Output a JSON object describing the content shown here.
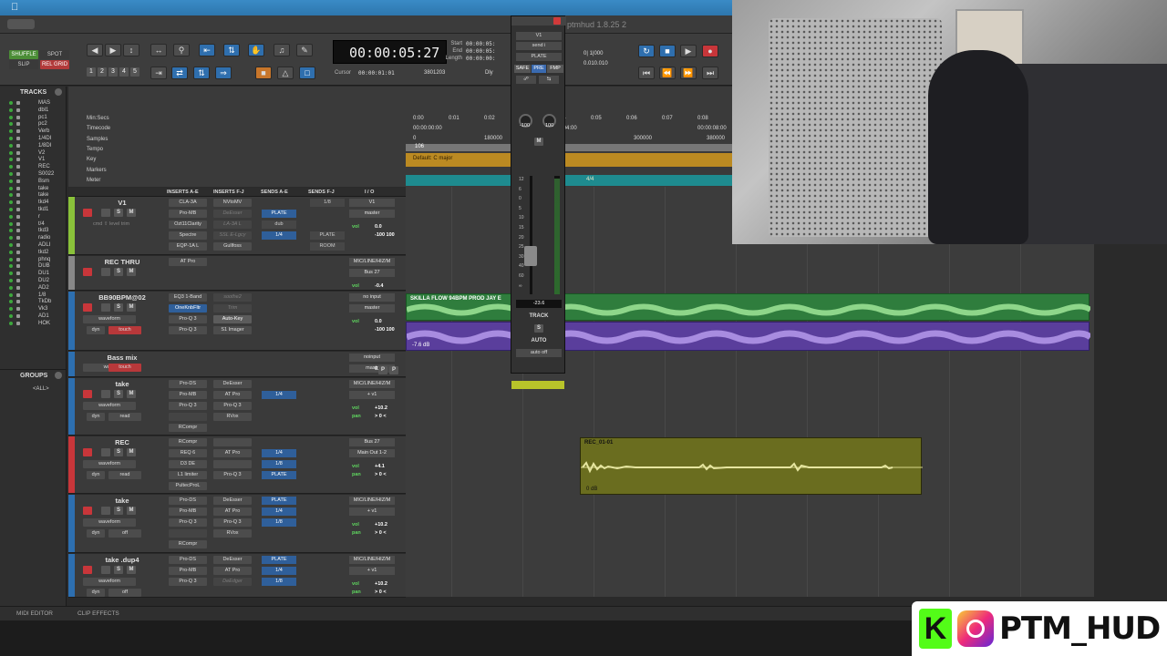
{
  "window": {
    "title": "ptmhud 1.8.25 2"
  },
  "toolbar": {
    "modes": [
      "SHUFFLE",
      "SPOT",
      "SLIP",
      "REL GRID"
    ],
    "counter": "00:00:05:27",
    "start_label": "Start",
    "end_label": "End",
    "length_label": "Length",
    "start_val": "00:00:05:",
    "end_val": "00:00:05:",
    "length_val": "00:00:00:",
    "cursor_label": "Cursor",
    "cursor_val": "00:00:01:01",
    "samples": "3801203",
    "dly_label": "Dly",
    "nudge_vals": [
      "0| 1|000",
      "0.010.010"
    ],
    "zoom_presets": [
      "1",
      "2",
      "3",
      "4",
      "5"
    ]
  },
  "tracks_panel": {
    "title": "TRACKS",
    "items": [
      "MAS",
      "dbl1",
      "pc1",
      "pc2",
      "Verb",
      "1/4DI",
      "1/8DI",
      "V2",
      "V1",
      "REC",
      "S0022",
      "Bsm",
      "take",
      "take",
      "tkd4",
      "tkd1",
      "r",
      "t/4",
      "tkd3",
      "radio",
      "ADLI",
      "tkd2",
      "phnq",
      "DUB",
      "DU1",
      "DU2",
      "AD2",
      "1/8",
      "TkDb",
      "Vk3",
      "AD1",
      "HOK"
    ]
  },
  "groups_panel": {
    "title": "GROUPS",
    "all_label": "<ALL>"
  },
  "rulers": [
    {
      "label": "Min:Secs"
    },
    {
      "label": "Timecode"
    },
    {
      "label": "Samples"
    },
    {
      "label": "Tempo"
    },
    {
      "label": "Key"
    },
    {
      "label": "Markers"
    },
    {
      "label": "Meter"
    }
  ],
  "min_secs_ticks": [
    "0:00",
    "0:01",
    "0:02",
    "0:03",
    "0:04",
    "0:05",
    "0:06",
    "0:07",
    "0:08"
  ],
  "timecode_ticks": [
    "00:00:00:00",
    "00:00:04:00",
    "00:00:08:00"
  ],
  "sample_ticks": [
    "0",
    "180000",
    "300000",
    "380000"
  ],
  "tempo_value": "106",
  "key_text": "Default: C major",
  "meter_text": "4/4",
  "column_headers": [
    "INSERTS A-E",
    "INSERTS F-J",
    "SENDS A-E",
    "SENDS F-J",
    "I / O"
  ],
  "tracks": [
    {
      "name": "V1",
      "color": "#8ac23a",
      "inserts_a": [
        "CLA-3A",
        "Pro-MB",
        "Ozt11Clarity",
        "Spectre",
        "EQP-1A L"
      ],
      "inserts_f": [
        "NVtoMV",
        "DeEsser",
        "LA-3A L",
        "SSL E-Lgcy",
        "Gullfoss"
      ],
      "sends_a": [
        "",
        "PLATE",
        "dub",
        "1/4"
      ],
      "sends_f": [
        "1/8",
        "",
        "",
        "PLATE",
        "ROOM"
      ],
      "io": [
        "V1",
        "master"
      ],
      "vol_label": "vol",
      "vol": "0.0",
      "pan": "-100  100",
      "extra": "cmd ⇧ level trim"
    },
    {
      "name": "REC THRU",
      "color": "#888888",
      "inserts_a": [
        "AT Pro"
      ],
      "io": [
        "MIC/LINE/HIZ/M",
        "Bus 27"
      ],
      "vol_label": "vol",
      "vol": "-0.4"
    },
    {
      "name": "BB90BPM@02",
      "color": "#2d6fb0",
      "inserts_a": [
        "EQ3 1-Band",
        "OneKnbFltr",
        "Pro-Q 3",
        "Pro-Q 3"
      ],
      "inserts_f": [
        "soothe2",
        "Trim",
        "Auto-Key",
        "S1 Imager"
      ],
      "io": [
        "no input",
        "master"
      ],
      "vol_label": "vol",
      "vol": "0.0",
      "pan": "-100  100",
      "mode": "touch",
      "view": "waveform",
      "dyn": "dyn"
    },
    {
      "name": "Bass mix",
      "color": "#2d6fb0",
      "io": [
        "noinput",
        "mastr"
      ],
      "vol": "0.0",
      "pan_l": "P",
      "pan_r": "P",
      "mode": "touch",
      "view": "wave"
    },
    {
      "name": "take",
      "color": "#2d6fb0",
      "inserts_a": [
        "Pro-DS",
        "Pro-MB",
        "Pro-Q 3",
        "",
        "RCompr"
      ],
      "inserts_f": [
        "DeEsser",
        "AT Pro",
        "Pro-Q 3",
        "RVox"
      ],
      "sends_a": [
        "",
        "1/4"
      ],
      "io": [
        "MIC/LINE/HIZ/M",
        "+ v1"
      ],
      "vol_label": "vol",
      "vol": "+10.2",
      "pan_label": "pan",
      "pan": "> 0 <",
      "mode": "read",
      "view": "waveform",
      "dyn": "dyn"
    },
    {
      "name": "REC",
      "color": "#c8363a",
      "inserts_a": [
        "RCompr",
        "REQ 6",
        "D3 DE",
        "L1 limiter",
        "PultecProL"
      ],
      "inserts_f": [
        "",
        "AT Pro",
        "",
        "Pro-Q 3"
      ],
      "sends_a": [
        "",
        "1/4",
        "1/8",
        "PLATE"
      ],
      "io": [
        "Bus 27",
        "Main Out 1-2"
      ],
      "vol_label": "vol",
      "vol": "+4.1",
      "pan_label": "pan",
      "pan": "> 0 <",
      "mode": "read",
      "view": "waveform",
      "dyn": "dyn"
    },
    {
      "name": "take",
      "color": "#2d6fb0",
      "inserts_a": [
        "Pro-DS",
        "Pro-MB",
        "Pro-Q 3",
        "",
        "RCompr"
      ],
      "inserts_f": [
        "DeEsser",
        "AT Pro",
        "Pro-Q 3",
        "RVox"
      ],
      "sends_a": [
        "PLATE",
        "1/4",
        "1/8"
      ],
      "io": [
        "MIC/LINE/HIZ/M",
        "+ v1"
      ],
      "vol_label": "vol",
      "vol": "+10.2",
      "pan_label": "pan",
      "pan": "> 0 <",
      "mode": "off",
      "view": "waveform",
      "dyn": "dyn"
    },
    {
      "name": "take .dup4",
      "color": "#2d6fb0",
      "inserts_a": [
        "Pro-DS",
        "Pro-MB",
        "Pro-Q 3"
      ],
      "inserts_f": [
        "DeEsser",
        "AT Pro",
        "DeEdger"
      ],
      "sends_a": [
        "PLATE",
        "1/4",
        "1/8"
      ],
      "io": [
        "MIC/LINE/HIZ/M",
        "+ v1"
      ],
      "vol_label": "vol",
      "vol": "+10.2",
      "pan_label": "pan",
      "pan": "> 0 <",
      "mode": "off",
      "view": "waveform",
      "dyn": "dyn"
    }
  ],
  "clips": {
    "beat_name": "SKILLA FLOW 94BPM PROD JAY E",
    "beat_db": "-7.6 dB",
    "rec_name": "REC_01-01",
    "rec_db": "0 dB"
  },
  "send_window": {
    "track": "V1",
    "send": "send i",
    "bus": "PLATE",
    "flags": [
      "SAFE",
      "PRE",
      "FMP"
    ],
    "pan_l": "-100",
    "pan_r": "100",
    "mute": "M",
    "level": "-23.6",
    "track_label": "TRACK",
    "solo": "S",
    "auto_label": "AUTO",
    "auto_mode": "auto off",
    "scale": [
      "12",
      "6",
      "0",
      "5",
      "10",
      "15",
      "20",
      "25",
      "30",
      "40",
      "60",
      "∞"
    ]
  },
  "bottom_bar": {
    "midi_editor": "MIDI EDITOR",
    "clip_effects": "CLIP EFFECTS"
  },
  "brand": {
    "handle": "PTM_HUD"
  }
}
